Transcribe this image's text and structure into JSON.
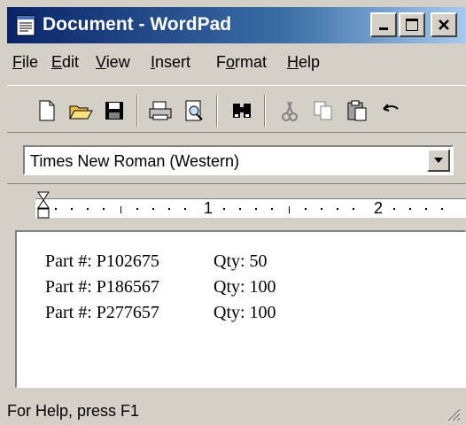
{
  "window": {
    "title": "Document - WordPad",
    "title_bar_color": "#0a246a"
  },
  "menu": [
    {
      "label": "File",
      "mnemonic": "F",
      "rest": "ile"
    },
    {
      "label": "Edit",
      "mnemonic": "E",
      "rest": "dit"
    },
    {
      "label": "View",
      "mnemonic": "V",
      "rest": "iew"
    },
    {
      "label": "Insert",
      "mnemonic": "I",
      "rest": "nsert"
    },
    {
      "label": "Format",
      "prefix": "F",
      "mnemonic": "o",
      "rest": "rmat"
    },
    {
      "label": "Help",
      "mnemonic": "H",
      "rest": "elp"
    }
  ],
  "toolbar": {
    "icons": [
      "new-document-icon",
      "open-folder-icon",
      "save-disk-icon",
      "print-icon",
      "print-preview-icon",
      "find-binoculars-icon",
      "cut-icon",
      "copy-icon",
      "paste-icon",
      "undo-icon"
    ]
  },
  "fontbar": {
    "font_value": "Times New Roman (Western)"
  },
  "ruler": {
    "labels": [
      "1",
      "2"
    ]
  },
  "document": {
    "lines": [
      {
        "part": "Part #: P102675",
        "qty": "Qty: 50"
      },
      {
        "part": "Part #: P186567",
        "qty": "Qty: 100"
      },
      {
        "part": "Part #: P277657",
        "qty": "Qty: 100"
      }
    ]
  },
  "status": {
    "text": "For Help, press F1"
  }
}
